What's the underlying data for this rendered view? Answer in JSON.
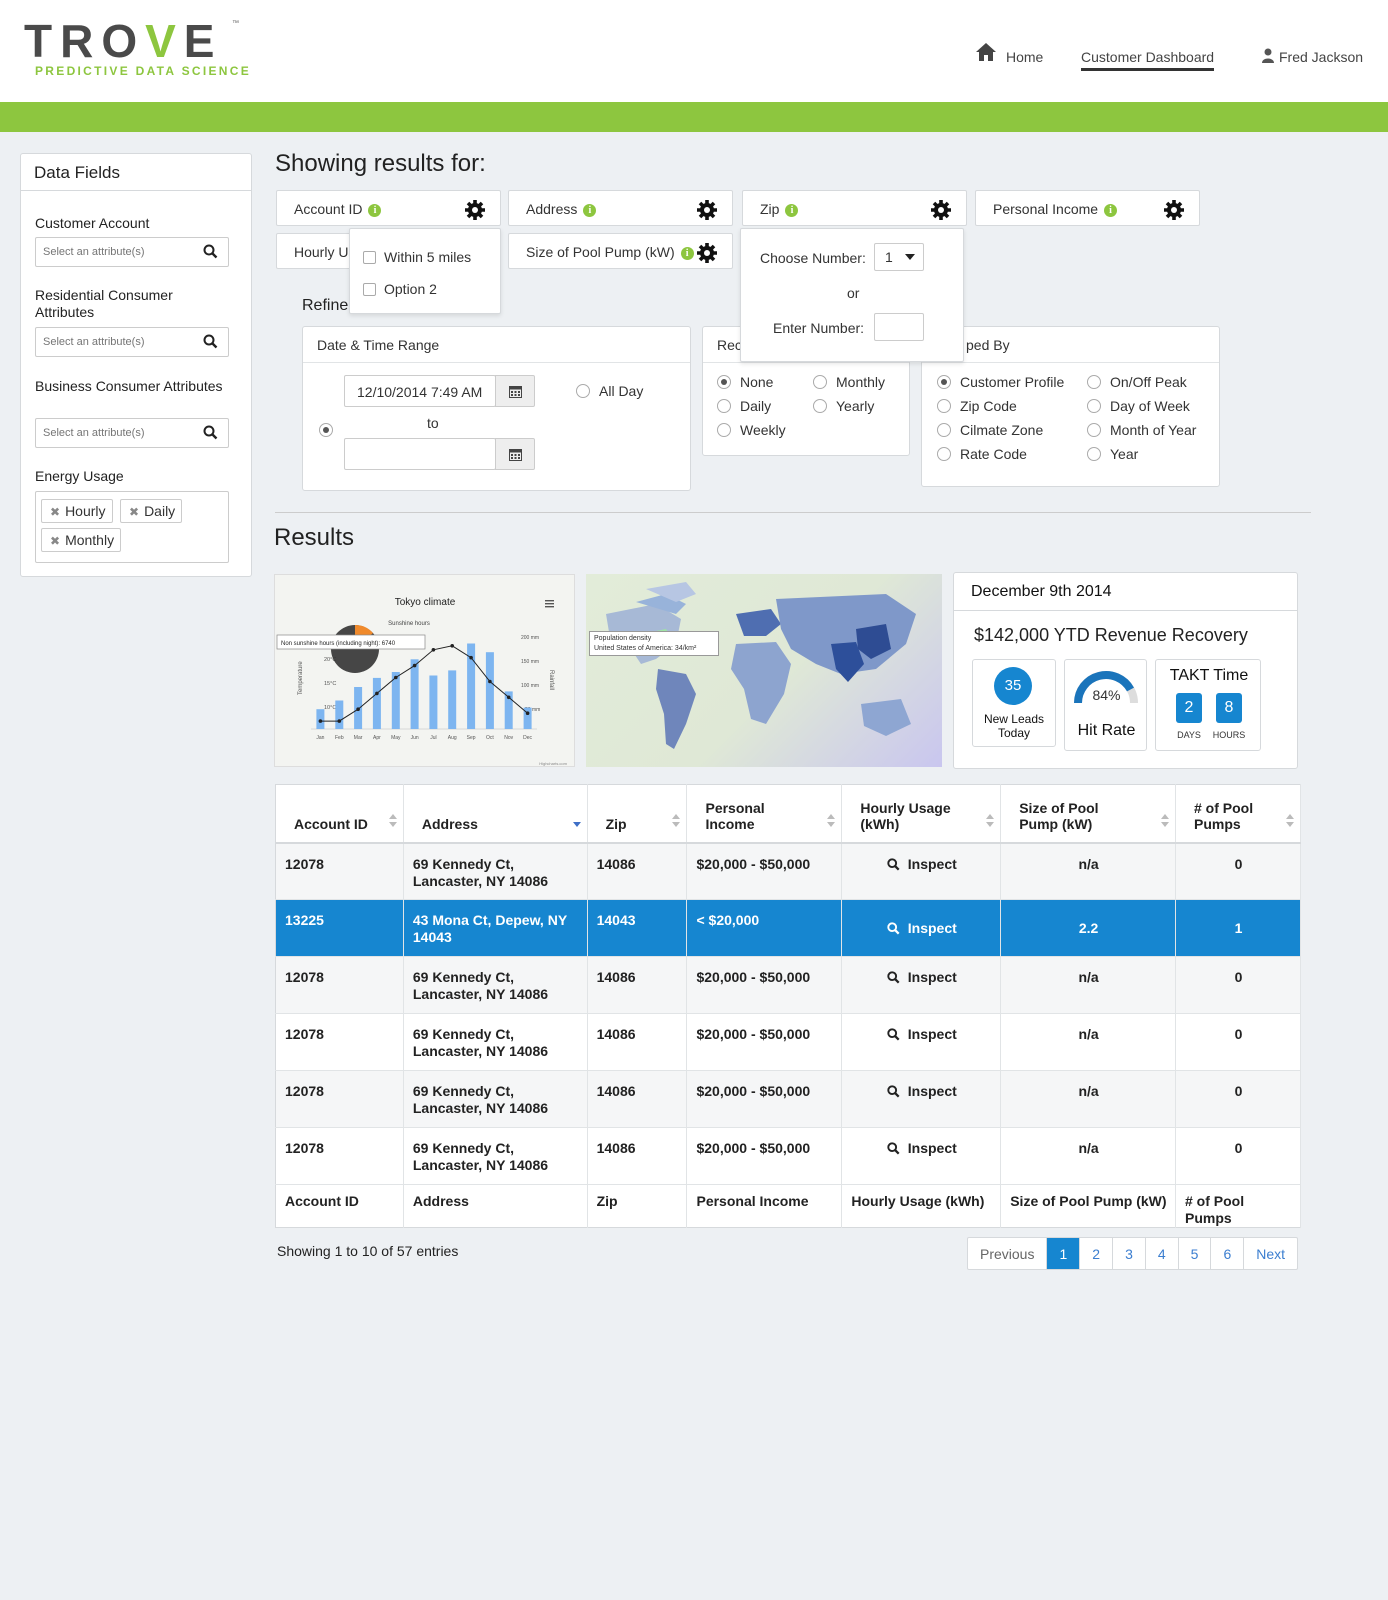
{
  "brand": {
    "name_a": "TRO",
    "name_v": "V",
    "name_e": "E",
    "tm": "™",
    "tagline": "PREDICTIVE DATA SCIENCE"
  },
  "nav": {
    "home": "Home",
    "dashboard": "Customer Dashboard",
    "user": "Fred Jackson"
  },
  "sidebar": {
    "title": "Data Fields",
    "customer_account": "Customer Account",
    "residential": "Residential Consumer Attributes",
    "business": "Business Consumer Attributes",
    "energy": "Energy Usage",
    "placeholder": "Select an attribute(s)",
    "energy_tags": [
      "Hourly",
      "Daily",
      "Monthly"
    ]
  },
  "filters": {
    "heading": "Showing results for:",
    "chips": [
      "Account ID",
      "Address",
      "Zip",
      "Personal Income",
      "Hourly Us",
      "Size of Pool Pump (kW)"
    ],
    "address_popup": [
      "Within 5 miles",
      "Option 2"
    ],
    "zip_popup": {
      "choose_label": "Choose Number:",
      "choose_value": "1",
      "or": "or",
      "enter_label": "Enter Number:"
    }
  },
  "refine": {
    "label": "Refine",
    "date_range": {
      "title": "Date & Time Range",
      "start": "12/10/2014 7:49 AM",
      "to": "to",
      "all_day": "All Day"
    },
    "recurrence": {
      "title": "Rec",
      "options": [
        "None",
        "Monthly",
        "Daily",
        "Yearly",
        "Weekly"
      ],
      "selected": "None"
    },
    "grouped": {
      "title": "ped By",
      "options": [
        "Customer Profile",
        "On/Off Peak",
        "Zip Code",
        "Day of Week",
        "Cilmate Zone",
        "Month of Year",
        "Rate Code",
        "Year"
      ],
      "selected": "Customer Profile"
    }
  },
  "results": {
    "heading": "Results",
    "chart_thumb": {
      "title": "Tokyo climate",
      "subtitle": "Sunshine hours",
      "tooltip": "Non sunshine hours (including night): 6740",
      "y_left_label": "Temperature",
      "y_right_label": "Rainfall",
      "temp_ticks": [
        "20°C",
        "15°C",
        "10°C"
      ],
      "rain_ticks": [
        "200 mm",
        "150 mm",
        "100 mm",
        "50 mm"
      ],
      "credit": "Highcharts.com"
    },
    "map_thumb": {
      "tooltip_title": "Population density",
      "tooltip_value": "United States of America: 34/km²"
    },
    "kpi": {
      "date": "December 9th 2014",
      "revenue": "$142,000 YTD Revenue Recovery",
      "leads_count": "35",
      "leads_label": "New Leads Today",
      "hit_pct": "84%",
      "hit_fraction": 0.84,
      "hit_label": "Hit Rate",
      "takt_title": "TAKT Time",
      "days": "2",
      "hours": "8",
      "days_label": "DAYS",
      "hours_label": "HOURS"
    }
  },
  "chart_data": {
    "type": "bar",
    "title": "Tokyo climate",
    "categories": [
      "Jan",
      "Feb",
      "Mar",
      "Apr",
      "May",
      "Jun",
      "Jul",
      "Aug",
      "Sep",
      "Oct",
      "Nov",
      "Dec"
    ],
    "series": [
      {
        "name": "Rainfall",
        "type": "bar",
        "values": [
          50,
          72,
          106,
          129,
          144,
          176,
          135,
          148,
          216,
          194,
          95,
          54
        ]
      },
      {
        "name": "Temperature",
        "type": "line",
        "values": [
          7,
          7,
          10,
          14,
          18,
          21,
          25,
          26,
          23,
          17,
          13,
          9
        ]
      }
    ],
    "ylim_rain": [
      0,
      250
    ],
    "ylim_temp": [
      5,
      30
    ]
  },
  "table": {
    "columns": [
      "Account ID",
      "Address",
      "Zip",
      "Personal Income",
      "Hourly Usage (kWh)",
      "Size of Pool Pump (kW)",
      "# of Pool Pumps"
    ],
    "rows": [
      {
        "id": "12078",
        "addr": "69 Kennedy Ct, Lancaster, NY  14086",
        "zip": "14086",
        "income": "$20,000 - $50,000",
        "hourly": "Inspect",
        "pump": "n/a",
        "count": "0"
      },
      {
        "id": "13225",
        "addr": "43 Mona Ct, Depew, NY 14043",
        "zip": "14043",
        "income": "< $20,000",
        "hourly": "Inspect",
        "pump": "2.2",
        "count": "1"
      },
      {
        "id": "12078",
        "addr": "69 Kennedy Ct, Lancaster, NY  14086",
        "zip": "14086",
        "income": "$20,000 - $50,000",
        "hourly": "Inspect",
        "pump": "n/a",
        "count": "0"
      },
      {
        "id": "12078",
        "addr": "69 Kennedy Ct, Lancaster, NY  14086",
        "zip": "14086",
        "income": "$20,000 - $50,000",
        "hourly": "Inspect",
        "pump": "n/a",
        "count": "0"
      },
      {
        "id": "12078",
        "addr": "69 Kennedy Ct, Lancaster, NY  14086",
        "zip": "14086",
        "income": "$20,000 - $50,000",
        "hourly": "Inspect",
        "pump": "n/a",
        "count": "0"
      },
      {
        "id": "12078",
        "addr": "69 Kennedy Ct, Lancaster, NY  14086",
        "zip": "14086",
        "income": "$20,000 - $50,000",
        "hourly": "Inspect",
        "pump": "n/a",
        "count": "0"
      }
    ],
    "entries": "Showing 1 to 10 of 57 entries"
  },
  "pagination": {
    "prev": "Previous",
    "pages": [
      "1",
      "2",
      "3",
      "4",
      "5",
      "6"
    ],
    "current": "1",
    "next": "Next"
  },
  "colors": {
    "brand_green": "#8dc63f",
    "accent_blue": "#1686d0"
  }
}
